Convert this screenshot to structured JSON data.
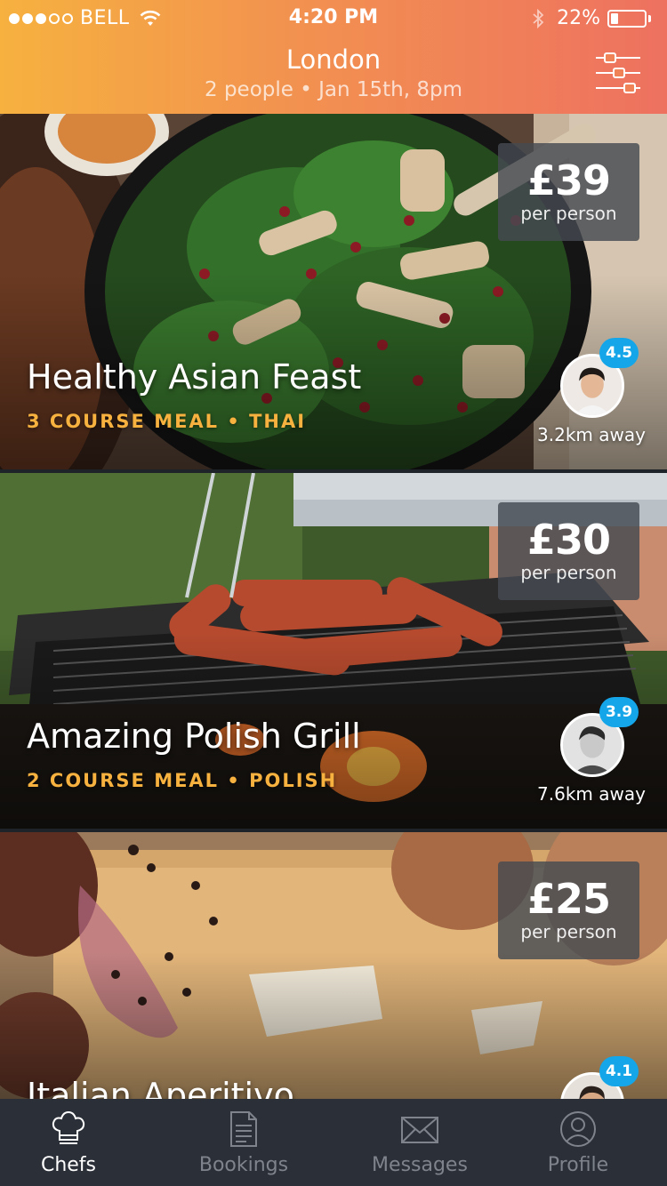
{
  "status_bar": {
    "signal_dots_filled": 3,
    "signal_dots_total": 5,
    "carrier": "BELL",
    "time": "4:20 PM",
    "battery_percent": "22%",
    "battery_level": 0.22,
    "icons": [
      "wifi-icon",
      "bluetooth-icon",
      "battery-icon"
    ]
  },
  "header": {
    "city": "London",
    "subtitle": "2 people • Jan 15th, 8pm",
    "filter_icon": "sliders-icon"
  },
  "cards": [
    {
      "price": "£39",
      "price_unit": "per person",
      "title": "Healthy Asian Feast",
      "meta": "3 COURSE MEAL • THAI",
      "rating": "4.5",
      "distance": "3.2km away"
    },
    {
      "price": "£30",
      "price_unit": "per person",
      "title": "Amazing Polish Grill",
      "meta": "2 COURSE MEAL • POLISH",
      "rating": "3.9",
      "distance": "7.6km away"
    },
    {
      "price": "£25",
      "price_unit": "per person",
      "title": "Italian Aperitivo",
      "rating": "4.1"
    }
  ],
  "tab_bar": {
    "tabs": [
      {
        "label": "Chefs",
        "icon": "chef-hat-icon",
        "active": true
      },
      {
        "label": "Bookings",
        "icon": "document-icon",
        "active": false
      },
      {
        "label": "Messages",
        "icon": "envelope-icon",
        "active": false
      },
      {
        "label": "Profile",
        "icon": "user-icon",
        "active": false
      }
    ]
  },
  "colors": {
    "header_gradient_start": "#f6b13f",
    "header_gradient_end": "#ee7160",
    "meta_accent": "#f6b13f",
    "rating_badge": "#14a6e8",
    "tab_bar_bg": "#2b2f38"
  }
}
